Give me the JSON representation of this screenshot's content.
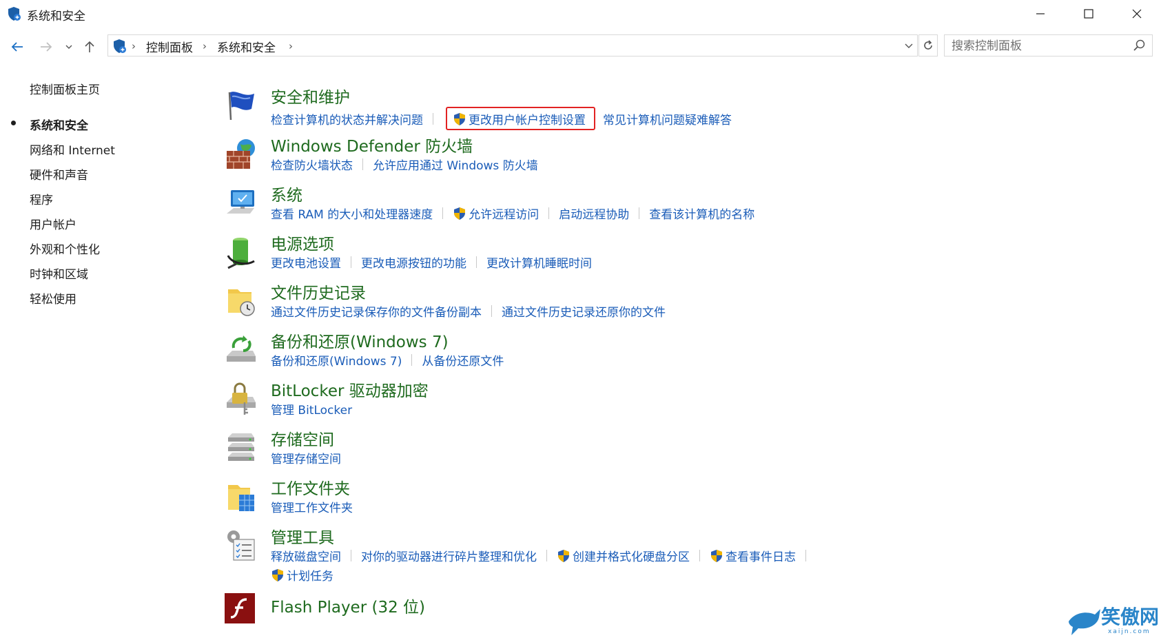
{
  "window": {
    "title": "系统和安全"
  },
  "address": {
    "crumbs": [
      "控制面板",
      "系统和安全"
    ]
  },
  "search": {
    "placeholder": "搜索控制面板"
  },
  "leftnav": {
    "home": "控制面板主页",
    "items": [
      "系统和安全",
      "网络和 Internet",
      "硬件和声音",
      "程序",
      "用户帐户",
      "外观和个性化",
      "时钟和区域",
      "轻松使用"
    ],
    "active_index": 0
  },
  "categories": [
    {
      "title": "安全和维护",
      "icon": "security-flag-icon",
      "links": [
        {
          "label": "检查计算机的状态并解决问题"
        },
        {
          "label": "更改用户帐户控制设置",
          "shield": true,
          "highlighted": true
        },
        {
          "label": "常见计算机问题疑难解答"
        }
      ]
    },
    {
      "title": "Windows Defender 防火墙",
      "icon": "firewall-icon",
      "links": [
        {
          "label": "检查防火墙状态"
        },
        {
          "label": "允许应用通过 Windows 防火墙"
        }
      ]
    },
    {
      "title": "系统",
      "icon": "computer-icon",
      "links": [
        {
          "label": "查看 RAM 的大小和处理器速度"
        },
        {
          "label": "允许远程访问",
          "shield": true
        },
        {
          "label": "启动远程协助"
        },
        {
          "label": "查看该计算机的名称"
        }
      ]
    },
    {
      "title": "电源选项",
      "icon": "battery-icon",
      "links": [
        {
          "label": "更改电池设置"
        },
        {
          "label": "更改电源按钮的功能"
        },
        {
          "label": "更改计算机睡眠时间"
        }
      ]
    },
    {
      "title": "文件历史记录",
      "icon": "file-history-icon",
      "links": [
        {
          "label": "通过文件历史记录保存你的文件备份副本"
        },
        {
          "label": "通过文件历史记录还原你的文件"
        }
      ]
    },
    {
      "title": "备份和还原(Windows 7)",
      "icon": "backup-icon",
      "links": [
        {
          "label": "备份和还原(Windows 7)"
        },
        {
          "label": "从备份还原文件"
        }
      ]
    },
    {
      "title": "BitLocker 驱动器加密",
      "icon": "bitlocker-icon",
      "links": [
        {
          "label": "管理 BitLocker"
        }
      ]
    },
    {
      "title": "存储空间",
      "icon": "storage-icon",
      "links": [
        {
          "label": "管理存储空间"
        }
      ]
    },
    {
      "title": "工作文件夹",
      "icon": "work-folders-icon",
      "links": [
        {
          "label": "管理工作文件夹"
        }
      ]
    },
    {
      "title": "管理工具",
      "icon": "admin-tools-icon",
      "links": [
        {
          "label": "释放磁盘空间"
        },
        {
          "label": "对你的驱动器进行碎片整理和优化"
        },
        {
          "label": "创建并格式化硬盘分区",
          "shield": true
        },
        {
          "label": "查看事件日志",
          "shield": true
        }
      ],
      "links2": [
        {
          "label": "计划任务",
          "shield": true
        }
      ]
    },
    {
      "title": "Flash Player (32 位)",
      "icon": "flash-icon",
      "links": []
    }
  ],
  "watermark": {
    "text": "笑傲网",
    "sub": "xaijn.com"
  },
  "colors": {
    "title_green": "#1e6a1e",
    "link_blue": "#1a5cb8",
    "highlight_red": "#e22222"
  }
}
